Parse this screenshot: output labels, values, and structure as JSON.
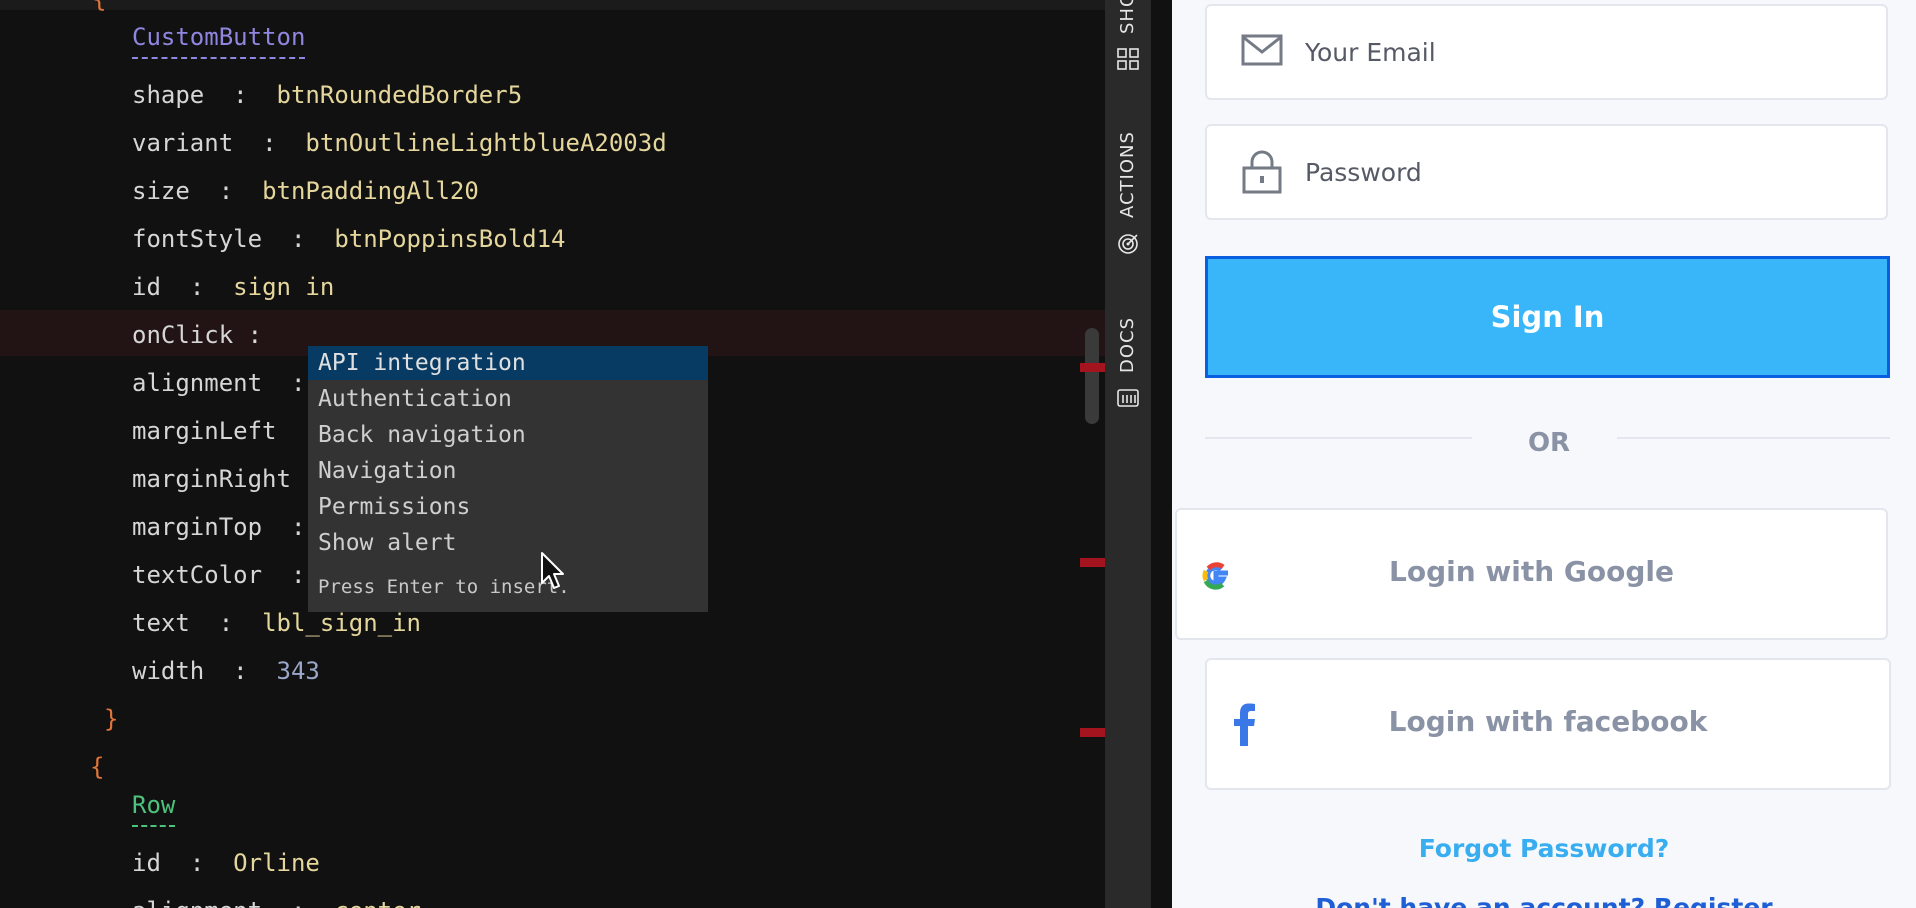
{
  "editor": {
    "component_name": "CustomButton",
    "props": [
      {
        "key": "shape",
        "value": "btnRoundedBorder5"
      },
      {
        "key": "variant",
        "value": "btnOutlineLightblueA2003d"
      },
      {
        "key": "size",
        "value": "btnPaddingAll20"
      },
      {
        "key": "fontStyle",
        "value": "btnPoppinsBold14"
      },
      {
        "key": "id",
        "value": "sign in"
      },
      {
        "key": "onClick",
        "value": ""
      },
      {
        "key": "alignment",
        "value": ""
      },
      {
        "key": "marginLeft",
        "value": ""
      },
      {
        "key": "marginRight",
        "value": ""
      },
      {
        "key": "marginTop",
        "value": ""
      },
      {
        "key": "textColor",
        "value": ""
      },
      {
        "key": "text",
        "value": "lbl_sign_in"
      },
      {
        "key": "width",
        "value": "343"
      }
    ],
    "separator": ":",
    "close_brace": "}",
    "open_brace": "{",
    "row_name": "Row",
    "row_props": [
      {
        "key": "id",
        "value": "Orline"
      },
      {
        "key": "alignment",
        "value": "center"
      }
    ],
    "top_brace": "{"
  },
  "autocomplete": {
    "items": [
      "API integration",
      "Authentication",
      "Back navigation",
      "Navigation",
      "Permissions",
      "Show alert"
    ],
    "selected_index": 0,
    "hint": "Press Enter to insert."
  },
  "sidebar": {
    "tabs": [
      {
        "label": "SHOW",
        "icon": "grid-icon"
      },
      {
        "label": "ACTIONS",
        "icon": "target-icon"
      },
      {
        "label": "DOCS",
        "icon": "docs-icon"
      }
    ]
  },
  "preview": {
    "email_placeholder": "Your Email",
    "password_placeholder": "Password",
    "sign_in_label": "Sign In",
    "or_label": "OR",
    "google_label": "Login with Google",
    "facebook_label": "Login with facebook",
    "forgot_label": "Forgot Password?",
    "register_label": "Don't have an account? Register",
    "colors": {
      "primary": "#38b6f9",
      "focus_border": "#0a5ee0",
      "muted_text": "#8a92a5"
    }
  }
}
